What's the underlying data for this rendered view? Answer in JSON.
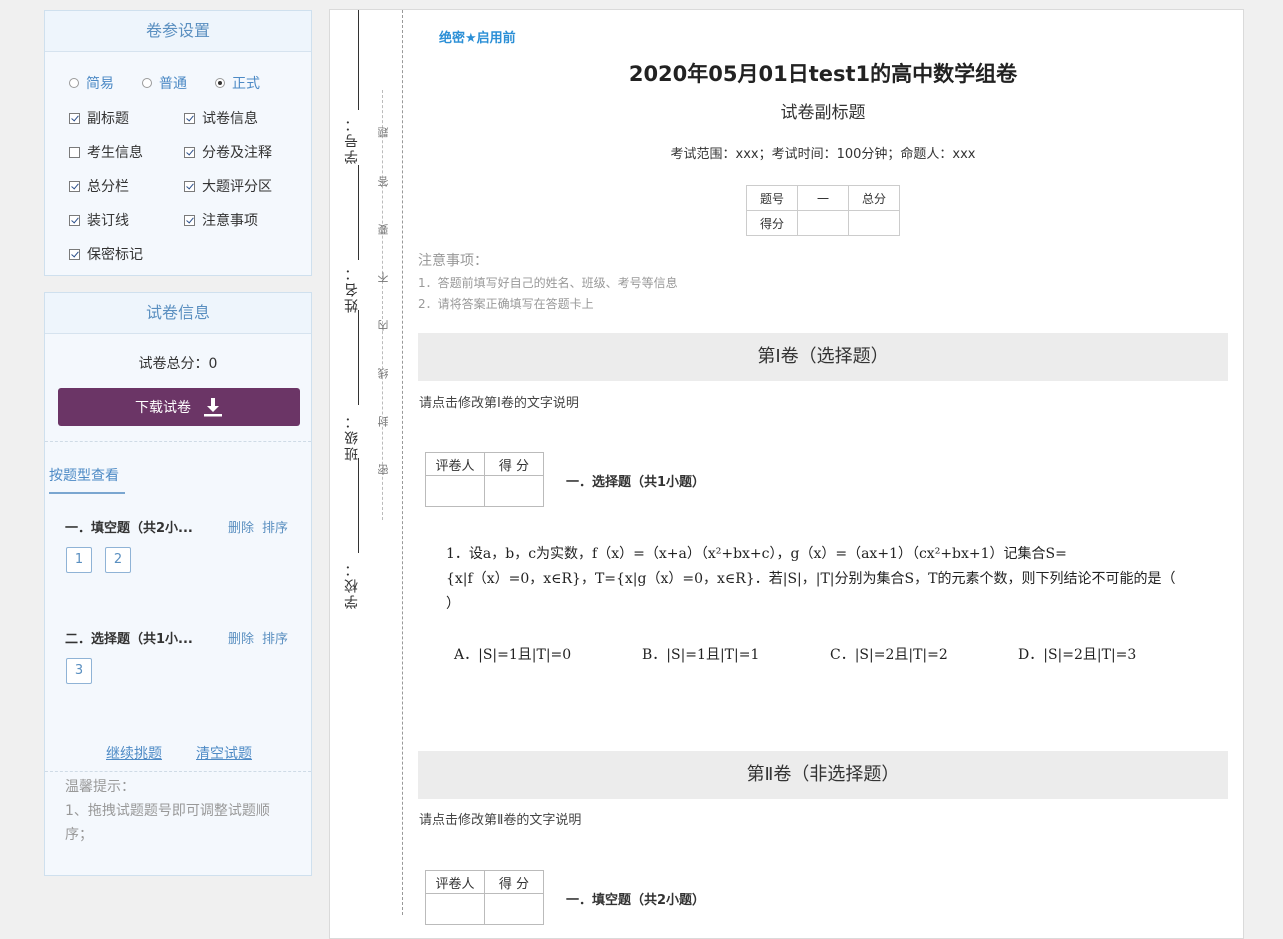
{
  "settings": {
    "title": "卷参设置",
    "modes": [
      {
        "label": "简易",
        "selected": false
      },
      {
        "label": "普通",
        "selected": false
      },
      {
        "label": "正式",
        "selected": true
      }
    ],
    "options": [
      {
        "label": "副标题",
        "checked": true
      },
      {
        "label": "试卷信息",
        "checked": true
      },
      {
        "label": "考生信息",
        "checked": false
      },
      {
        "label": "分卷及注释",
        "checked": true
      },
      {
        "label": "总分栏",
        "checked": true
      },
      {
        "label": "大题评分区",
        "checked": true
      },
      {
        "label": "装订线",
        "checked": true
      },
      {
        "label": "注意事项",
        "checked": true
      },
      {
        "label": "保密标记",
        "checked": true
      }
    ]
  },
  "paper_info": {
    "title": "试卷信息",
    "total_score": "试卷总分：0",
    "download_label": "下载试卷",
    "tab_label": "按题型查看",
    "groups": [
      {
        "title": "一．填空题（共2小...",
        "delete": "删除",
        "sort": "排序",
        "nums": [
          "1",
          "2"
        ]
      },
      {
        "title": "二．选择题（共1小...",
        "delete": "删除",
        "sort": "排序",
        "nums": [
          "3"
        ]
      }
    ],
    "continue_label": "继续挑题",
    "clear_label": "清空试题",
    "tip_title": "温馨提示：",
    "tip_line1": "1、拖拽试题题号即可调整试题顺",
    "tip_line2": "序；"
  },
  "paper": {
    "binding": {
      "labels": [
        "学号：",
        "姓名：",
        "班级：",
        "学校："
      ],
      "chars": [
        "题",
        "答",
        "要",
        "不",
        "内",
        "线",
        "封",
        "密"
      ]
    },
    "secret_mark": "绝密★启用前",
    "title": "2020年05月01日test1的高中数学组卷",
    "subtitle": "试卷副标题",
    "exam_info": "考试范围：xxx；考试时间：100分钟；命题人：xxx",
    "score_table": {
      "row1": [
        "题号",
        "一",
        "总分"
      ],
      "row2": [
        "得分",
        "",
        ""
      ]
    },
    "notes": {
      "head": "注意事项：",
      "items": [
        "1．答题前填写好自己的姓名、班级、考号等信息",
        "2．请将答案正确填写在答题卡上"
      ]
    },
    "part1": {
      "title": "第Ⅰ卷（选择题）",
      "desc": "请点击修改第Ⅰ卷的文字说明",
      "grader": [
        "评卷人",
        "得  分"
      ],
      "heading": "一．选择题（共1小题）"
    },
    "question": {
      "line1": "1．设a，b，c为实数，f（x）=（x+a）（x²+bx+c），g（x）=（ax+1）（cx²+bx+1）记集合S=",
      "line2": "{x|f（x）=0，x∈R}，T={x|g（x）=0，x∈R}．若|S|，|T|分别为集合S，T的元素个数，则下列结论不可能的是（",
      "line3": "）",
      "options": [
        "A．|S|=1且|T|=0",
        "B．|S|=1且|T|=1",
        "C．|S|=2且|T|=2",
        "D．|S|=2且|T|=3"
      ]
    },
    "part2": {
      "title": "第Ⅱ卷（非选择题）",
      "desc": "请点击修改第Ⅱ卷的文字说明",
      "grader": [
        "评卷人",
        "得  分"
      ],
      "heading": "一．填空题（共2小题）"
    }
  }
}
